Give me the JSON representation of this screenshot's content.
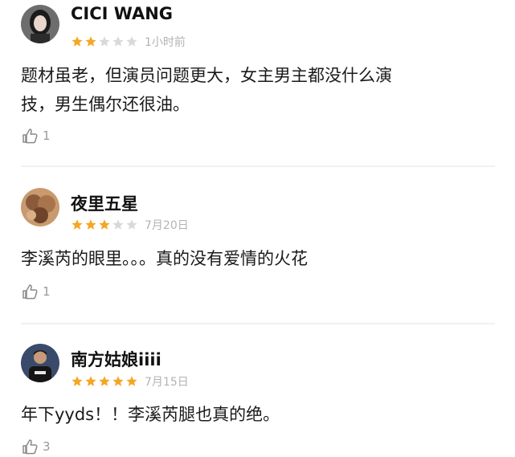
{
  "colors": {
    "star_filled": "#f5a623",
    "star_empty": "#d9d9d9",
    "muted": "#b3b3b3"
  },
  "reviews": [
    {
      "username": "CICI WANG",
      "rating": 2,
      "max_rating": 5,
      "time": "1小时前",
      "content_lines": [
        "题材虽老，但演员问题更大，女主男主都没什么演",
        "技，男生偶尔还很油。"
      ],
      "likes": "1",
      "avatar_icon": "user-avatar-icon"
    },
    {
      "username": "夜里五星",
      "rating": 3,
      "max_rating": 5,
      "time": "7月20日",
      "content_lines": [
        "李溪芮的眼里。。。真的没有爱情的火花"
      ],
      "likes": "1",
      "avatar_icon": "user-avatar-icon"
    },
    {
      "username": "南方姑娘iiii",
      "rating": 5,
      "max_rating": 5,
      "time": "7月15日",
      "content_lines": [
        "年下yyds！！李溪芮腿也真的绝。"
      ],
      "likes": "3",
      "avatar_icon": "user-avatar-icon"
    }
  ]
}
